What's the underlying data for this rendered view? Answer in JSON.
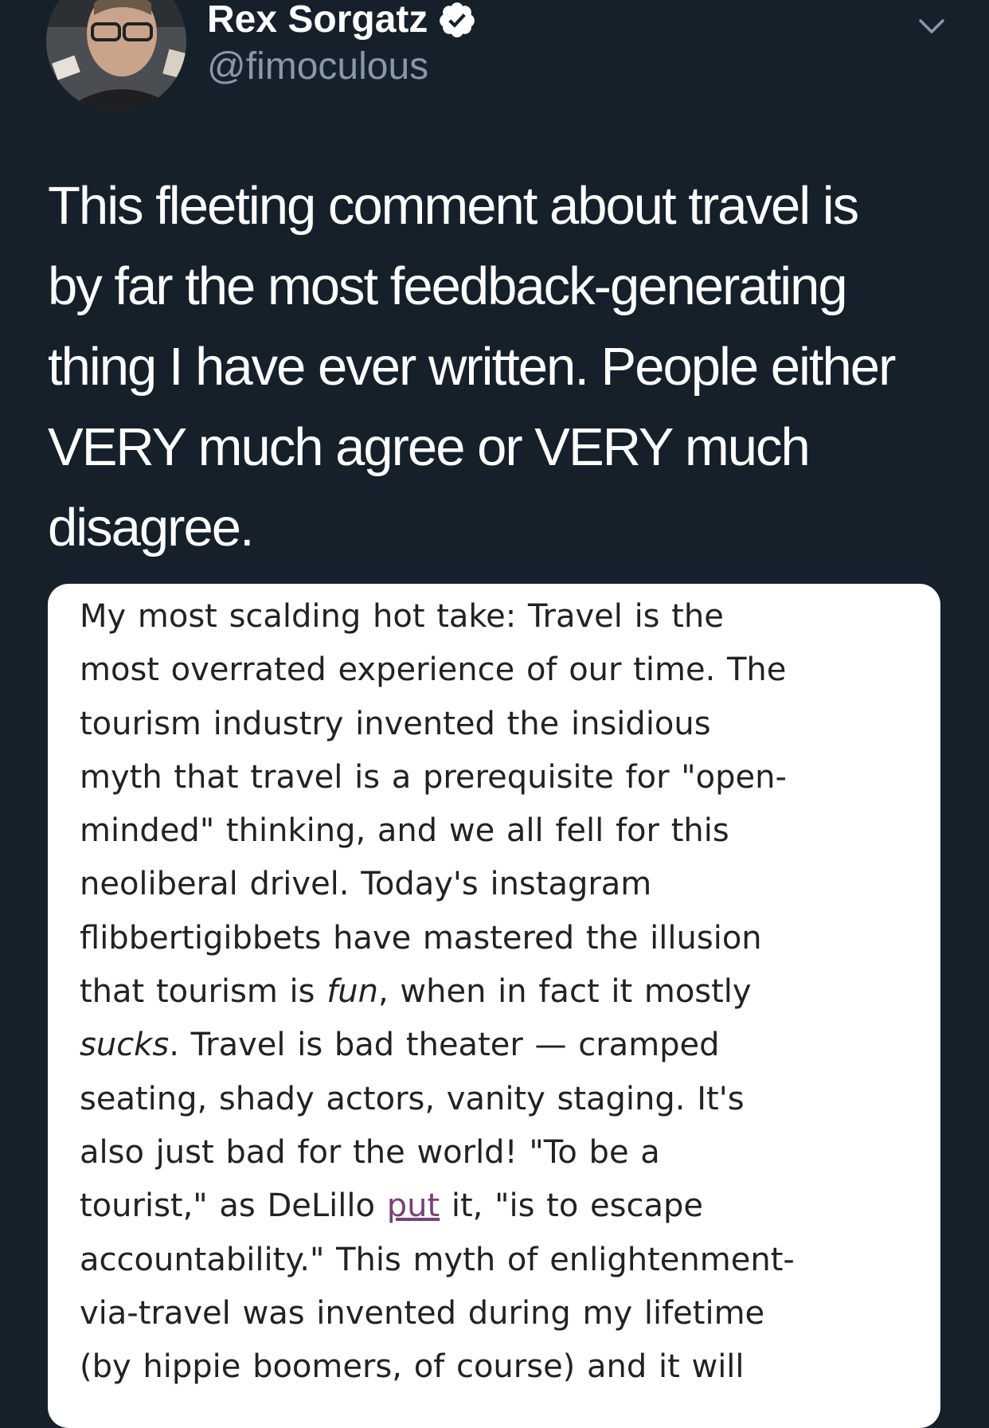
{
  "author": {
    "display_name": "Rex Sorgatz",
    "handle": "@fimoculous",
    "verified": true,
    "avatar_icon": "avatar-photo"
  },
  "icons": {
    "verified": "verified-badge-icon",
    "menu": "chevron-down-icon"
  },
  "tweet": {
    "text_lines": [
      "This fleeting comment about travel is",
      "by far the most feedback-generating",
      "thing I have ever written. People either",
      "VERY much agree or VERY much",
      "disagree."
    ]
  },
  "media": {
    "lines": {
      "l1": "My most scalding hot take: Travel is the",
      "l2": "most overrated experience of our time. The",
      "l3": "tourism industry invented the insidious",
      "l4": "myth that travel is a prerequisite for \"open-",
      "l5": "minded\" thinking, and we all fell for this",
      "l6": "neoliberal drivel. Today's instagram",
      "l7": "flibbertigibbets have mastered the illusion",
      "l8_a": "that tourism is ",
      "l8_em": "fun",
      "l8_b": ", when in fact it mostly",
      "l9_em": "sucks",
      "l9_b": ". Travel is bad theater — cramped",
      "l10": "seating, shady actors, vanity staging. It's",
      "l11": "also just bad for the world! \"To be a",
      "l12_a": "tourist,\" as DeLillo ",
      "l12_link": "put",
      "l12_b": " it, \"is to escape",
      "l13": "accountability.\" This myth of enlightenment-",
      "l14": "via-travel was invented during my lifetime",
      "l15": "(by hippie boomers, of course) and it will"
    }
  },
  "colors": {
    "background": "#15202b",
    "text_primary": "#ffffff",
    "text_secondary": "#8899a6",
    "verified": "#ffffff",
    "link_visited": "#7a3f7a"
  }
}
